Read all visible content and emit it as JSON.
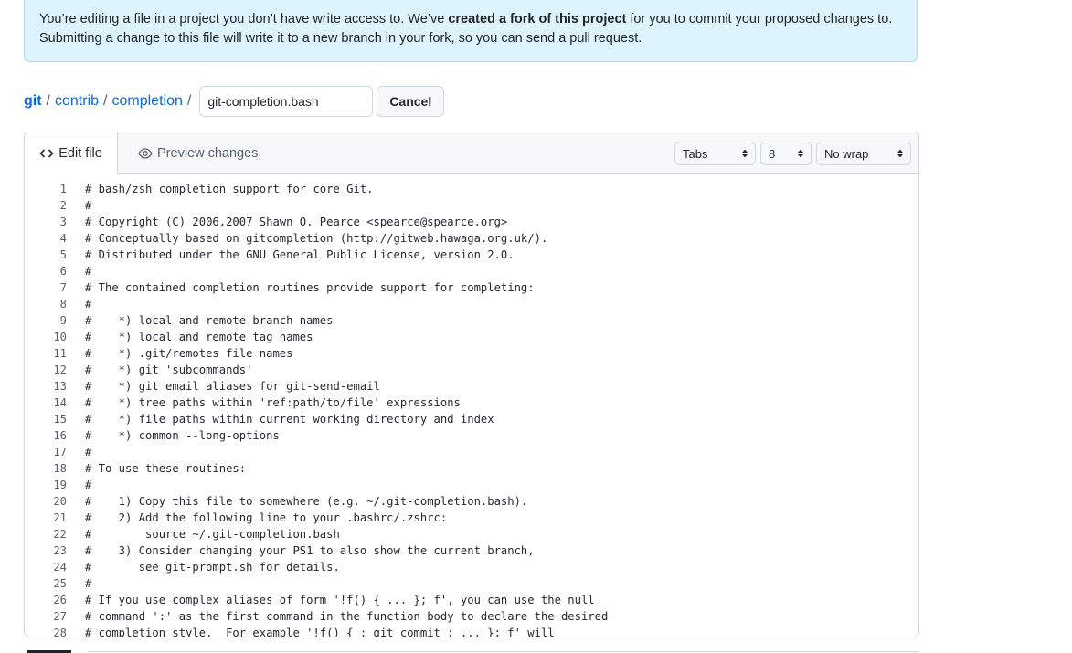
{
  "notice": {
    "part1": "You’re editing a file in a project you don’t have write access to. We’ve ",
    "bold": "created a fork of this project",
    "part2": " for you to commit your proposed changes to.",
    "line2": "Submitting a change to this file will write it to a new branch in your fork, so you can send a pull request."
  },
  "breadcrumb": {
    "items": [
      "git",
      "contrib",
      "completion"
    ],
    "separator": "/",
    "filename_value": "git-completion.bash",
    "cancel_label": "Cancel"
  },
  "editor": {
    "tabs": {
      "edit_label": "Edit file",
      "preview_label": "Preview changes"
    },
    "indent_mode": "Tabs",
    "indent_size": "8",
    "wrap_mode": "No wrap",
    "lines": [
      {
        "n": "1",
        "t": "# bash/zsh completion support for core Git."
      },
      {
        "n": "2",
        "t": "#"
      },
      {
        "n": "3",
        "t": "# Copyright (C) 2006,2007 Shawn O. Pearce <spearce@spearce.org>"
      },
      {
        "n": "4",
        "t": "# Conceptually based on gitcompletion (http://gitweb.hawaga.org.uk/)."
      },
      {
        "n": "5",
        "t": "# Distributed under the GNU General Public License, version 2.0."
      },
      {
        "n": "6",
        "t": "#"
      },
      {
        "n": "7",
        "t": "# The contained completion routines provide support for completing:"
      },
      {
        "n": "8",
        "t": "#"
      },
      {
        "n": "9",
        "t": "#    *) local and remote branch names"
      },
      {
        "n": "10",
        "t": "#    *) local and remote tag names"
      },
      {
        "n": "11",
        "t": "#    *) .git/remotes file names"
      },
      {
        "n": "12",
        "t": "#    *) git 'subcommands'"
      },
      {
        "n": "13",
        "t": "#    *) git email aliases for git-send-email"
      },
      {
        "n": "14",
        "t": "#    *) tree paths within 'ref:path/to/file' expressions"
      },
      {
        "n": "15",
        "t": "#    *) file paths within current working directory and index"
      },
      {
        "n": "16",
        "t": "#    *) common --long-options"
      },
      {
        "n": "17",
        "t": "#"
      },
      {
        "n": "18",
        "t": "# To use these routines:"
      },
      {
        "n": "19",
        "t": "#"
      },
      {
        "n": "20",
        "t": "#    1) Copy this file to somewhere (e.g. ~/.git-completion.bash)."
      },
      {
        "n": "21",
        "t": "#    2) Add the following line to your .bashrc/.zshrc:"
      },
      {
        "n": "22",
        "t": "#        source ~/.git-completion.bash"
      },
      {
        "n": "23",
        "t": "#    3) Consider changing your PS1 to also show the current branch,"
      },
      {
        "n": "24",
        "t": "#       see git-prompt.sh for details."
      },
      {
        "n": "25",
        "t": "#"
      },
      {
        "n": "26",
        "t": "# If you use complex aliases of form '!f() { ... }; f', you can use the null"
      },
      {
        "n": "27",
        "t": "# command ':' as the first command in the function body to declare the desired"
      },
      {
        "n": "28",
        "t": "# completion style.  For example '!f() { : git commit ; ... }; f' will"
      }
    ]
  }
}
